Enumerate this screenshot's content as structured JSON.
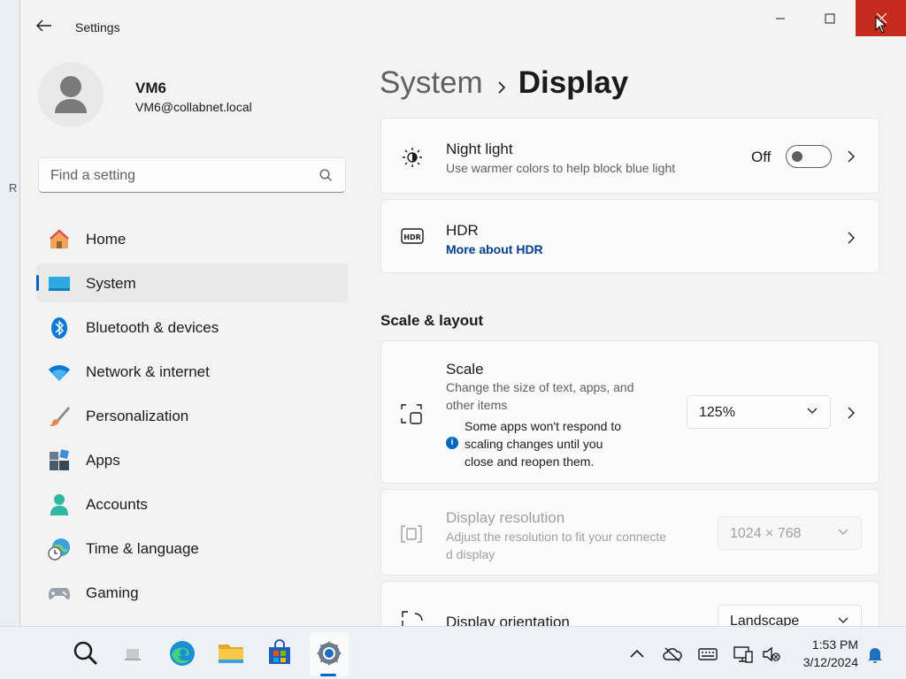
{
  "window": {
    "title": "Settings"
  },
  "user": {
    "name": "VM6",
    "email": "VM6@collabnet.local"
  },
  "search": {
    "placeholder": "Find a setting"
  },
  "nav": [
    {
      "label": "Home",
      "icon": "home-icon"
    },
    {
      "label": "System",
      "icon": "system-icon",
      "active": true
    },
    {
      "label": "Bluetooth & devices",
      "icon": "bluetooth-icon"
    },
    {
      "label": "Network & internet",
      "icon": "wifi-icon"
    },
    {
      "label": "Personalization",
      "icon": "brush-icon"
    },
    {
      "label": "Apps",
      "icon": "apps-icon"
    },
    {
      "label": "Accounts",
      "icon": "accounts-icon"
    },
    {
      "label": "Time & language",
      "icon": "globe-clock-icon"
    },
    {
      "label": "Gaming",
      "icon": "gamepad-icon"
    }
  ],
  "breadcrumb": {
    "parent": "System",
    "current": "Display"
  },
  "night_light": {
    "title": "Night light",
    "subtitle": "Use warmer colors to help block blue light",
    "state": "Off"
  },
  "hdr": {
    "title": "HDR",
    "link": "More about HDR"
  },
  "scale_layout": {
    "heading": "Scale & layout",
    "scale": {
      "title": "Scale",
      "subtitle_line1": "Change the size of text, apps, and",
      "subtitle_line2": "other items",
      "warning_line1": "Some apps won't respond to",
      "warning_line2": "scaling changes until you",
      "warning_line3": "close and reopen them.",
      "value": "125%"
    },
    "resolution": {
      "title": "Display resolution",
      "subtitle_line1": "Adjust the resolution to fit your connecte",
      "subtitle_line2": "d display",
      "value": "1024 × 768"
    },
    "orientation": {
      "title": "Display orientation",
      "value": "Landscape"
    }
  },
  "taskbar": {
    "clock": {
      "time": "1:53 PM",
      "date": "3/12/2024"
    }
  },
  "colors": {
    "accent": "#0067c0",
    "close": "#c42b1c"
  }
}
